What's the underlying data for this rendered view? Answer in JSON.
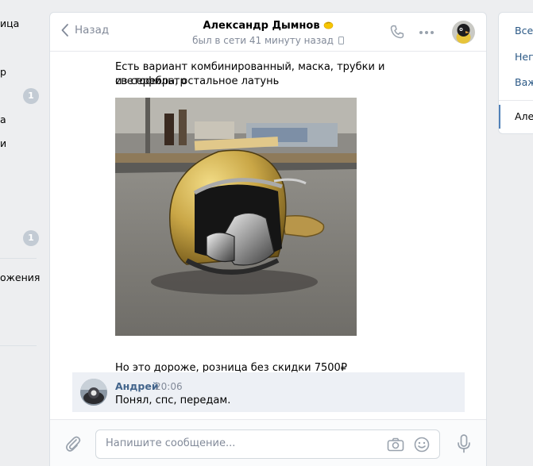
{
  "left_nav": {
    "items": [
      {
        "label": "ица"
      },
      {
        "label": "р"
      },
      {
        "label": "а"
      },
      {
        "label": "и"
      },
      {
        "label": "ожения"
      }
    ],
    "badges": [
      "1",
      "1"
    ]
  },
  "chat": {
    "back_label": "Назад",
    "peer_name": "Александр Дымнов",
    "peer_status": "был в сети 41 минуту назад",
    "messages": {
      "text_1_line_1": "Есть вариант комбинированный, маска, трубки и светофильтр",
      "text_1_line_2": "из серебра, остальное латунь",
      "text_2": "Но это дороже, розница без скидки 7500₽"
    },
    "reply": {
      "author": "Андрей",
      "time": "20:06",
      "text": "Понял, спс, передам."
    },
    "composer": {
      "placeholder": "Напишите сообщение..."
    }
  },
  "right_panel": {
    "filters": [
      "Все",
      "Неп",
      "Важ"
    ],
    "active_conversation": "Але"
  },
  "colors": {
    "page_bg": "#edeef0",
    "link": "#2a5885",
    "author": "#42648b",
    "muted": "#828a99",
    "icon": "#99a2ad",
    "reply_bg": "#edf0f5",
    "accent": "#5181b8"
  },
  "icons": {
    "back": "chevron-left-icon",
    "call": "phone-icon",
    "more": "more-dots-icon",
    "attach": "paperclip-icon",
    "camera": "camera-icon",
    "smile": "smile-icon",
    "mic": "microphone-icon",
    "online_mobile": "mobile-device-icon"
  }
}
